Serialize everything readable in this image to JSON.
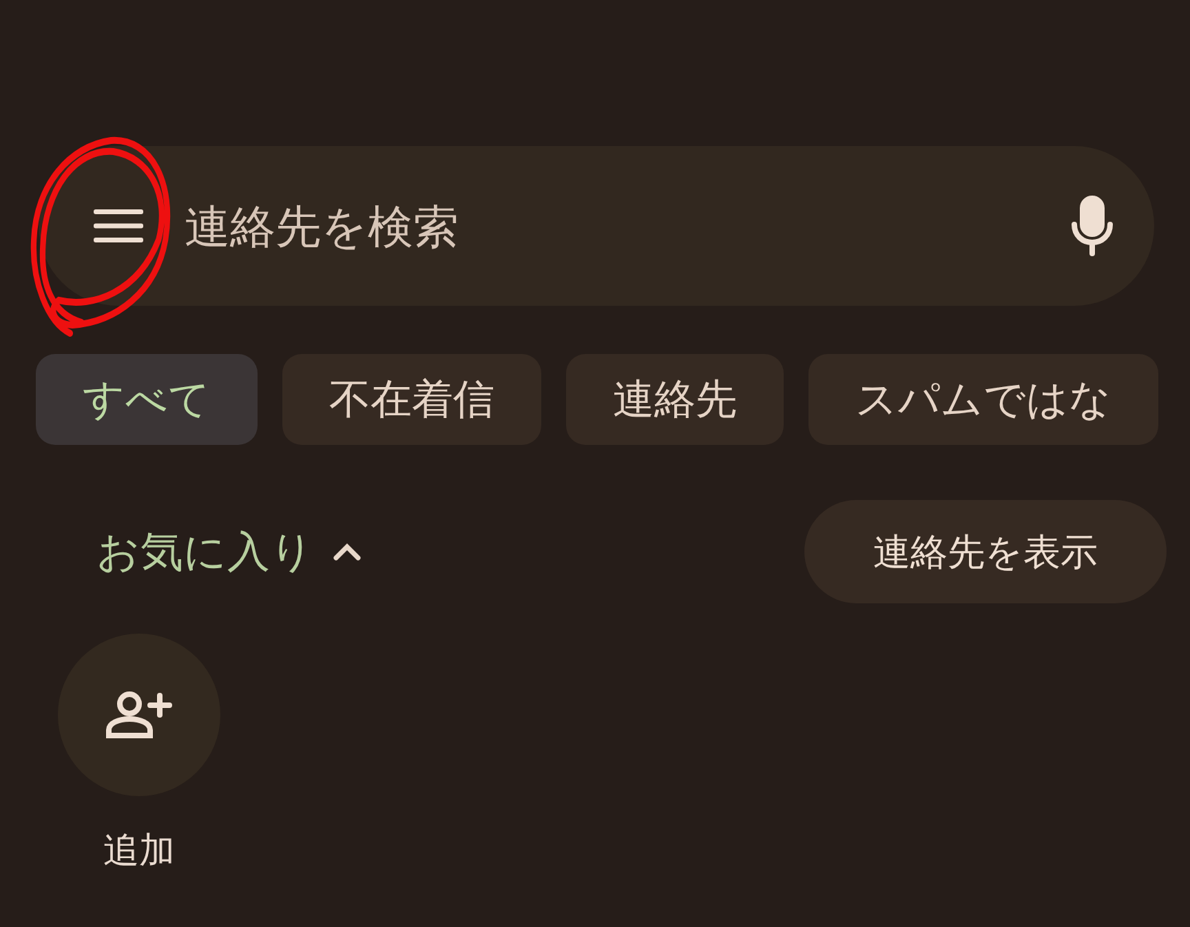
{
  "search": {
    "placeholder": "連絡先を検索"
  },
  "filters": [
    {
      "label": "すべて",
      "selected": true
    },
    {
      "label": "不在着信",
      "selected": false
    },
    {
      "label": "連絡先",
      "selected": false
    },
    {
      "label": "スパムではな",
      "selected": false
    }
  ],
  "favorites": {
    "title": "お気に入り",
    "expanded": true,
    "action": "連絡先を表示",
    "items": [
      {
        "kind": "add",
        "label": "追加"
      }
    ]
  },
  "annotation": {
    "kind": "circle"
  }
}
